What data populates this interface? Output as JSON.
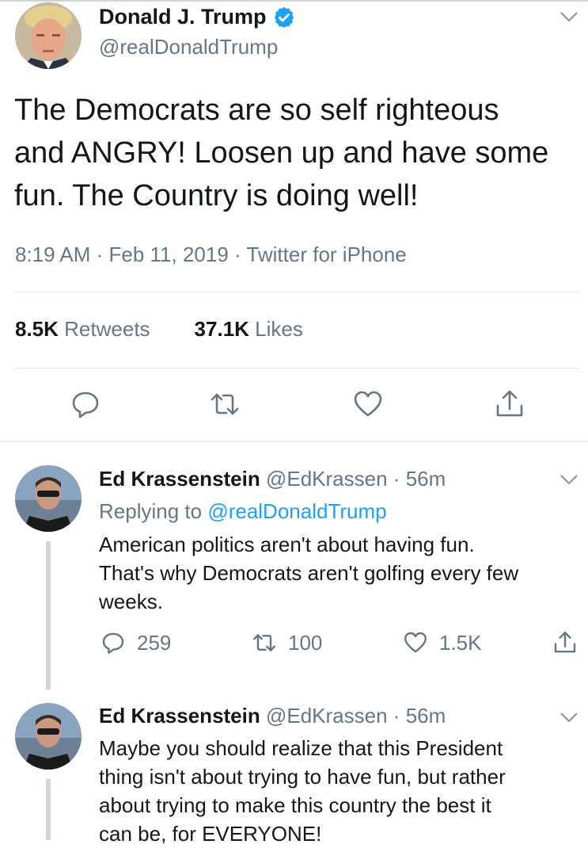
{
  "main_tweet": {
    "author_name": "Donald J. Trump",
    "handle": "@realDonaldTrump",
    "text_lines": [
      "The Democrats are so self righteous",
      "and ANGRY! Loosen up and have some",
      "fun. The Country is doing well!"
    ],
    "meta": "8:19 AM · Feb 11, 2019 · Twitter for iPhone",
    "retweets_count": "8.5K",
    "retweets_label": "Retweets",
    "likes_count": "37.1K",
    "likes_label": "Likes"
  },
  "replies": [
    {
      "author_name": "Ed Krassenstein",
      "handle": "@EdKrassen",
      "time": "56m",
      "replying_prefix": "Replying to",
      "replying_to": "@realDonaldTrump",
      "text_lines": [
        "American politics aren't about having fun.",
        "That's why Democrats aren't golfing every few",
        "weeks."
      ],
      "reply_count": "259",
      "retweet_count": "100",
      "like_count": "1.5K"
    },
    {
      "author_name": "Ed Krassenstein",
      "handle": "@EdKrassen",
      "time": "56m",
      "text_lines": [
        "Maybe you should realize that this President",
        "thing isn't about trying to have fun, but rather",
        "about trying to make this country the best it",
        "can be, for EVERYONE!"
      ]
    }
  ],
  "colors": {
    "text": "#14171a",
    "secondary": "#657786",
    "link": "#1da1f2",
    "verified": "#1da1f2",
    "divider": "#e1e8ed"
  }
}
